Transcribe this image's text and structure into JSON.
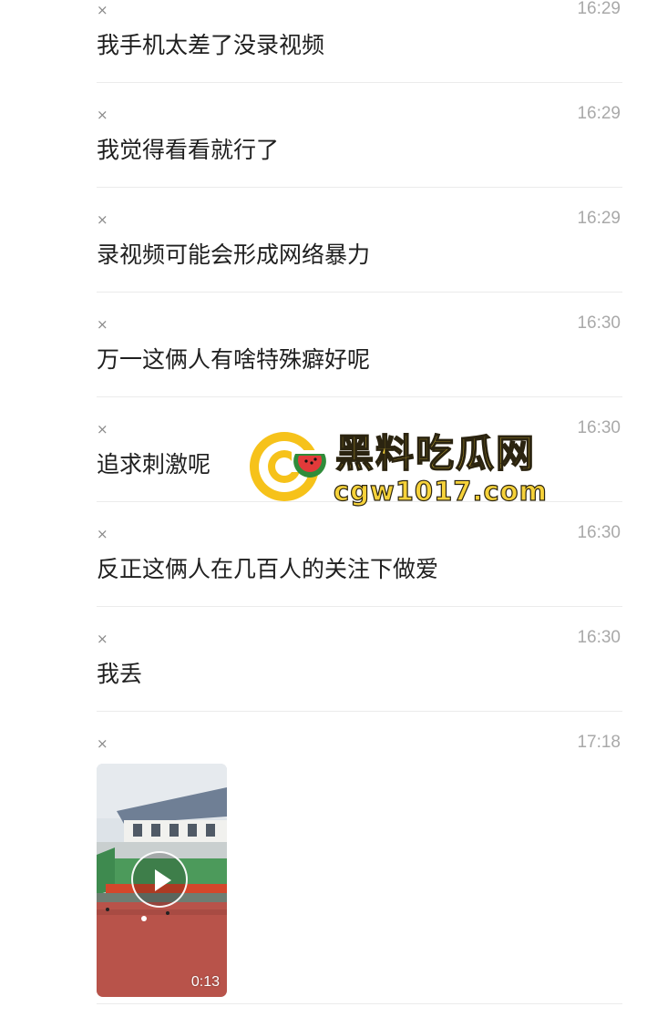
{
  "messages": [
    {
      "sender_mark": "×",
      "time": "16:29",
      "text": "我手机太差了没录视频"
    },
    {
      "sender_mark": "×",
      "time": "16:29",
      "text": "我觉得看看就行了"
    },
    {
      "sender_mark": "×",
      "time": "16:29",
      "text": "录视频可能会形成网络暴力"
    },
    {
      "sender_mark": "×",
      "time": "16:30",
      "text": "万一这俩人有啥特殊癖好呢"
    },
    {
      "sender_mark": "×",
      "time": "16:30",
      "text": "追求刺激呢"
    },
    {
      "sender_mark": "×",
      "time": "16:30",
      "text": "反正这俩人在几百人的关注下做爱"
    },
    {
      "sender_mark": "×",
      "time": "16:30",
      "text": "我丢"
    }
  ],
  "video_message": {
    "sender_mark": "×",
    "time": "17:18",
    "duration": "0:13"
  },
  "watermark": {
    "title": "黑料吃瓜网",
    "url": "cgw1017.com"
  },
  "colors": {
    "text": "#1f1f1f",
    "time": "#a9a9a9",
    "divider": "#ebebeb",
    "watermark_yellow": "#f6d23a"
  }
}
